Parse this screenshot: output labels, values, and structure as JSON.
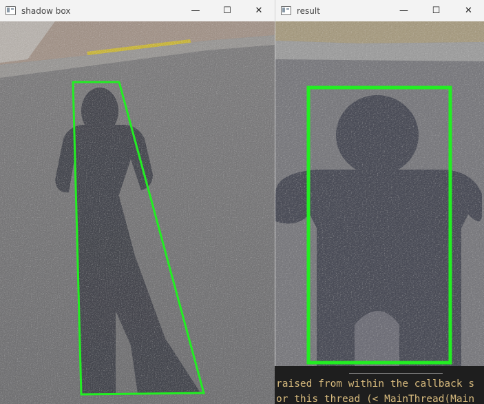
{
  "left_window": {
    "title": "shadow box",
    "minimize_glyph": "—",
    "maximize_glyph": "☐",
    "close_glyph": "✕",
    "icon": "opencv-window-icon"
  },
  "right_window": {
    "title": "result",
    "minimize_glyph": "—",
    "maximize_glyph": "☐",
    "close_glyph": "✕",
    "icon": "opencv-window-icon"
  },
  "terminal": {
    "line1": "raised from within the callback s",
    "line2": "or this thread (< MainThread(Main"
  },
  "colors": {
    "box_outline": "#22ee22",
    "terminal_text": "#d7ba7d",
    "asphalt": "#6e6e70"
  }
}
